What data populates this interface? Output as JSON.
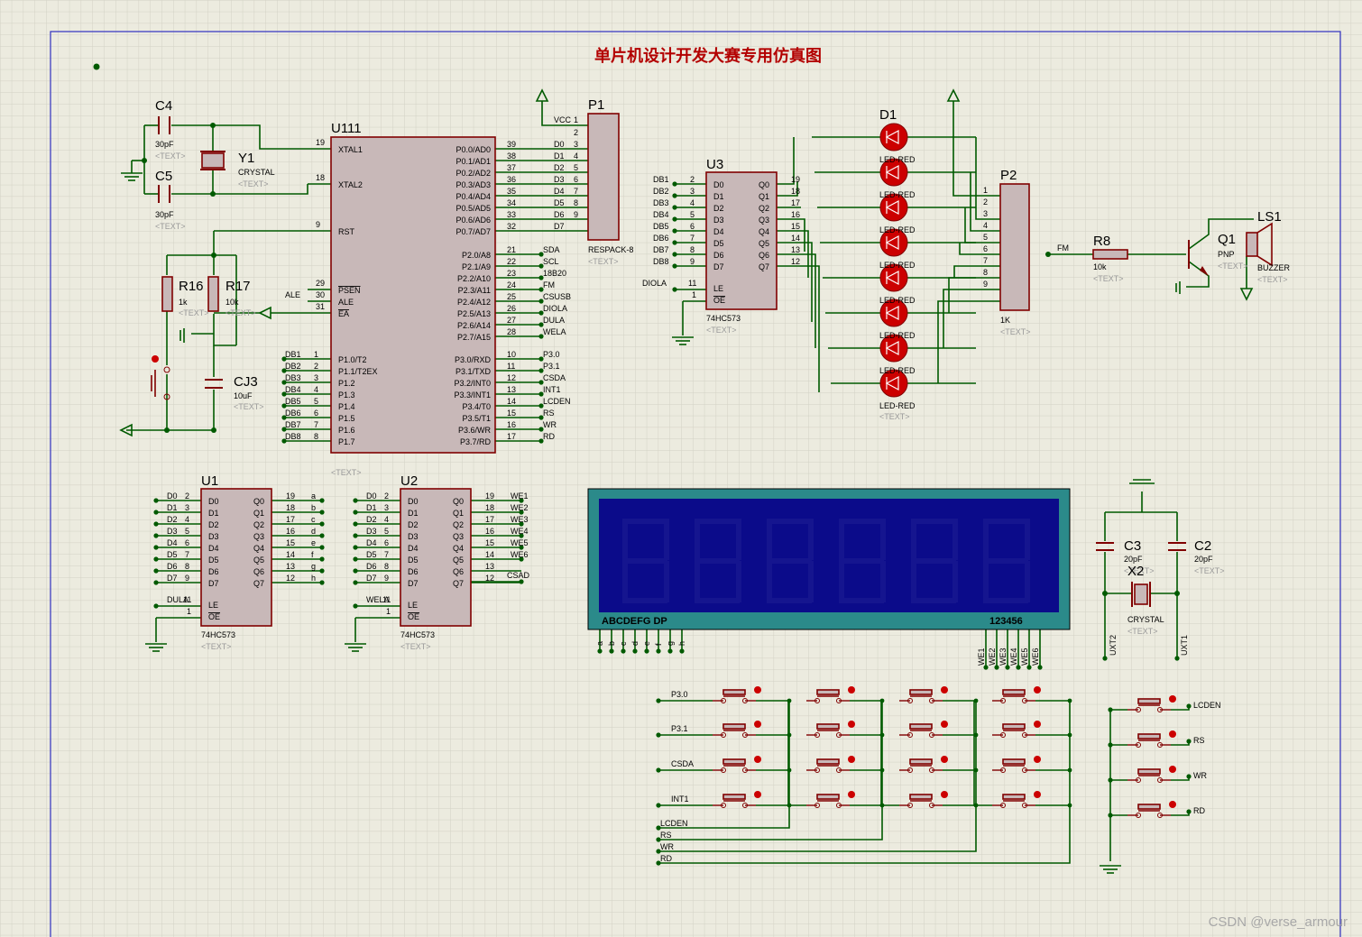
{
  "title": "单片机设计开发大赛专用仿真图",
  "watermark": "CSDN @verse_armour",
  "colors": {
    "wire": "#005a00",
    "body": "#800000",
    "fill": "#c8b8b8",
    "text": "#000000",
    "muted": "#9a9a9a",
    "lcd_outer": "#2b8a8a",
    "lcd_inner": "#0b0b8a",
    "led": "#cc0000"
  },
  "text_placeholder": "<TEXT>",
  "mcu": {
    "ref": "U111",
    "left_pins": [
      {
        "num": "19",
        "name": "XTAL1"
      },
      {
        "num": "18",
        "name": "XTAL2"
      },
      {
        "num": "9",
        "name": "RST"
      },
      {
        "num": "29",
        "name": "PSEN"
      },
      {
        "num": "30",
        "name": "ALE"
      },
      {
        "num": "31",
        "name": "EA"
      },
      {
        "num": "1",
        "name": "P1.0/T2",
        "net": "DB1"
      },
      {
        "num": "2",
        "name": "P1.1/T2EX",
        "net": "DB2"
      },
      {
        "num": "3",
        "name": "P1.2",
        "net": "DB3"
      },
      {
        "num": "4",
        "name": "P1.3",
        "net": "DB4"
      },
      {
        "num": "5",
        "name": "P1.4",
        "net": "DB5"
      },
      {
        "num": "6",
        "name": "P1.5",
        "net": "DB6"
      },
      {
        "num": "7",
        "name": "P1.6",
        "net": "DB7"
      },
      {
        "num": "8",
        "name": "P1.7",
        "net": "DB8"
      }
    ],
    "ale_net": "ALE",
    "right_pins": [
      {
        "num": "39",
        "name": "P0.0/AD0",
        "net": "D0"
      },
      {
        "num": "38",
        "name": "P0.1/AD1",
        "net": "D1"
      },
      {
        "num": "37",
        "name": "P0.2/AD2",
        "net": "D2"
      },
      {
        "num": "36",
        "name": "P0.3/AD3",
        "net": "D3"
      },
      {
        "num": "35",
        "name": "P0.4/AD4",
        "net": "D4"
      },
      {
        "num": "34",
        "name": "P0.5/AD5",
        "net": "D5"
      },
      {
        "num": "33",
        "name": "P0.6/AD6",
        "net": "D6"
      },
      {
        "num": "32",
        "name": "P0.7/AD7",
        "net": "D7"
      },
      {
        "num": "21",
        "name": "P2.0/A8",
        "net": "SDA"
      },
      {
        "num": "22",
        "name": "P2.1/A9",
        "net": "SCL"
      },
      {
        "num": "23",
        "name": "P2.2/A10",
        "net": "18B20"
      },
      {
        "num": "24",
        "name": "P2.3/A11",
        "net": "FM"
      },
      {
        "num": "25",
        "name": "P2.4/A12",
        "net": "CSUSB"
      },
      {
        "num": "26",
        "name": "P2.5/A13",
        "net": "DIOLA"
      },
      {
        "num": "27",
        "name": "P2.6/A14",
        "net": "DULA"
      },
      {
        "num": "28",
        "name": "P2.7/A15",
        "net": "WELA"
      },
      {
        "num": "10",
        "name": "P3.0/RXD",
        "net": "P3.0"
      },
      {
        "num": "11",
        "name": "P3.1/TXD",
        "net": "P3.1"
      },
      {
        "num": "12",
        "name": "P3.2/INT0",
        "net": "CSDA"
      },
      {
        "num": "13",
        "name": "P3.3/INT1",
        "net": "INT1"
      },
      {
        "num": "14",
        "name": "P3.4/T0",
        "net": "LCDEN"
      },
      {
        "num": "15",
        "name": "P3.5/T1",
        "net": "RS"
      },
      {
        "num": "16",
        "name": "P3.6/WR",
        "net": "WR"
      },
      {
        "num": "17",
        "name": "P3.7/RD",
        "net": "RD"
      }
    ]
  },
  "caps": {
    "c4": {
      "ref": "C4",
      "val": "30pF"
    },
    "c5": {
      "ref": "C5",
      "val": "30pF"
    },
    "cj3": {
      "ref": "CJ3",
      "val": "10uF"
    },
    "c3": {
      "ref": "C3",
      "val": "20pF"
    },
    "c2": {
      "ref": "C2",
      "val": "20pF"
    }
  },
  "crystals": {
    "y1": {
      "ref": "Y1",
      "val": "CRYSTAL"
    },
    "x2": {
      "ref": "X2",
      "val": "CRYSTAL"
    }
  },
  "resistors": {
    "r16": {
      "ref": "R16",
      "val": "1k"
    },
    "r17": {
      "ref": "R17",
      "val": "10k"
    },
    "r8": {
      "ref": "R8",
      "val": "10k"
    }
  },
  "respack": {
    "ref": "P1",
    "val": "RESPACK-8",
    "vcc": "VCC",
    "pin_nums": [
      "1",
      "2",
      "3",
      "4",
      "5",
      "6",
      "7",
      "8",
      "9"
    ]
  },
  "p2": {
    "ref": "P2",
    "val": "1K",
    "pin_nums": [
      "1",
      "2",
      "3",
      "4",
      "5",
      "6",
      "7",
      "8",
      "9"
    ]
  },
  "latch": {
    "part": "74HC573",
    "in_pins": [
      {
        "n": "2",
        "l": "D0"
      },
      {
        "n": "3",
        "l": "D1"
      },
      {
        "n": "4",
        "l": "D2"
      },
      {
        "n": "5",
        "l": "D3"
      },
      {
        "n": "6",
        "l": "D4"
      },
      {
        "n": "7",
        "l": "D5"
      },
      {
        "n": "8",
        "l": "D6"
      },
      {
        "n": "9",
        "l": "D7"
      }
    ],
    "out_pins": [
      {
        "n": "19",
        "l": "Q0"
      },
      {
        "n": "18",
        "l": "Q1"
      },
      {
        "n": "17",
        "l": "Q2"
      },
      {
        "n": "16",
        "l": "Q3"
      },
      {
        "n": "15",
        "l": "Q4"
      },
      {
        "n": "14",
        "l": "Q5"
      },
      {
        "n": "13",
        "l": "Q6"
      },
      {
        "n": "12",
        "l": "Q7"
      }
    ],
    "le": "LE",
    "oe": "OE",
    "le_num": "11",
    "oe_num": "1"
  },
  "u1": {
    "ref": "U1",
    "in_nets": [
      "D0",
      "D1",
      "D2",
      "D3",
      "D4",
      "D5",
      "D6",
      "D7"
    ],
    "out_nets": [
      "a",
      "b",
      "c",
      "d",
      "e",
      "f",
      "g",
      "h"
    ],
    "le_net": "DULA"
  },
  "u2": {
    "ref": "U2",
    "in_nets": [
      "D0",
      "D1",
      "D2",
      "D3",
      "D4",
      "D5",
      "D6",
      "D7"
    ],
    "out_nets": [
      "WE1",
      "WE2",
      "WE3",
      "WE4",
      "WE5",
      "WE6",
      "",
      ""
    ],
    "le_net": "WELA",
    "extra_net": "CSAD"
  },
  "u3": {
    "ref": "U3",
    "in_nets": [
      "DB1",
      "DB2",
      "DB3",
      "DB4",
      "DB5",
      "DB6",
      "DB7",
      "DB8"
    ],
    "le_net": "DIOLA"
  },
  "leds": {
    "ref": "D1",
    "val": "LED-RED",
    "count": 8
  },
  "buzzer": {
    "ls_ref": "LS1",
    "ls_val": "BUZZER",
    "q_ref": "Q1",
    "q_val": "PNP",
    "net": "FM"
  },
  "display": {
    "seg_label": "ABCDEFG  DP",
    "dig_label": "123456",
    "seg_pins": [
      "a",
      "b",
      "c",
      "d",
      "e",
      "f",
      "g",
      "h"
    ],
    "dig_pins": [
      "WE1",
      "WE2",
      "WE3",
      "WE4",
      "WE5",
      "WE6"
    ]
  },
  "keypad": {
    "rows": [
      "P3.0",
      "P3.1",
      "CSDA",
      "INT1"
    ],
    "cols": [
      "LCDEN",
      "RS",
      "WR",
      "RD"
    ]
  },
  "side_keys": [
    "LCDEN",
    "RS",
    "WR",
    "RD"
  ],
  "xtal2_nets": {
    "left": "UXT2",
    "right": "UXT1"
  }
}
